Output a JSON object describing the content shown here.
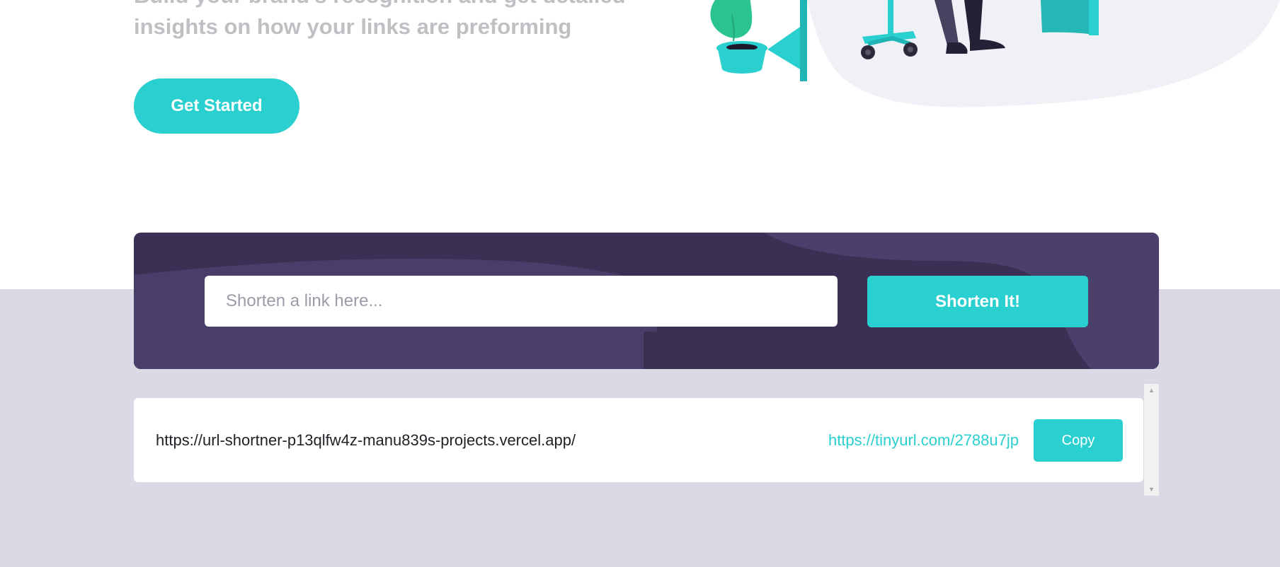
{
  "hero": {
    "subtitle": "Build your brand's recognition and get detailed insights on how your links are preforming",
    "cta_label": "Get Started"
  },
  "shortener": {
    "placeholder": "Shorten a link here...",
    "input_value": "",
    "button_label": "Shorten It!"
  },
  "results": [
    {
      "original": "https://url-shortner-p13qlfw4z-manu839s-projects.vercel.app/",
      "short": "https://tinyurl.com/2788u7jp",
      "copy_label": "Copy"
    }
  ],
  "scrollbar": {
    "up_icon": "▲",
    "down_icon": "▼"
  },
  "colors": {
    "accent": "#2acfcf",
    "dark_violet": "#3b3054",
    "band": "#dbd9e5",
    "subtitle_gray": "#bfbfc4"
  }
}
